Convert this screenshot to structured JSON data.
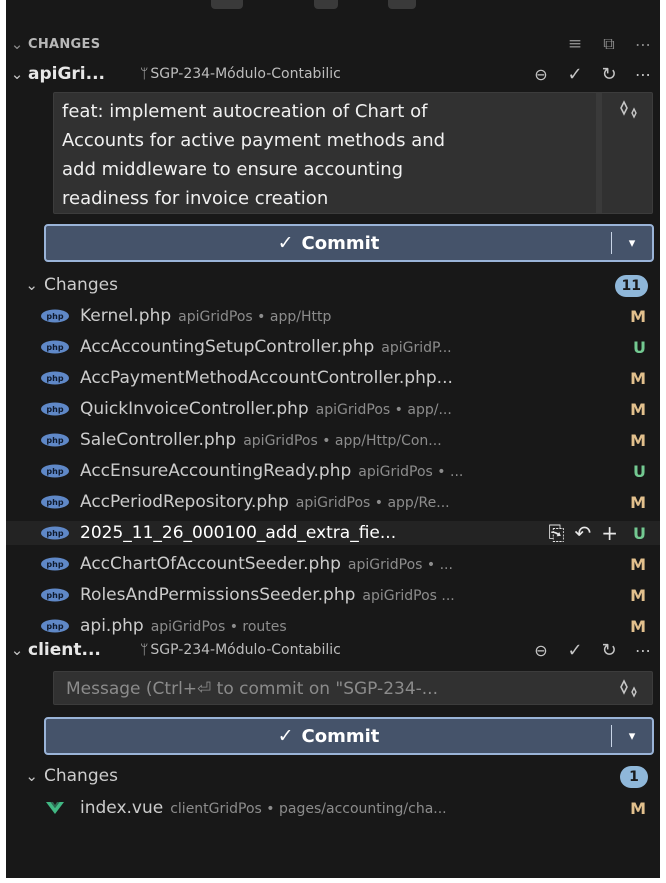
{
  "section": {
    "title": "CHANGES",
    "actions": [
      "list-view-icon",
      "collapse-all-icon",
      "more-icon"
    ]
  },
  "repos": [
    {
      "name": "apiGri...",
      "branch": "SGP-234-Módulo-Contabilic",
      "commit_message": "feat: implement autocreation of Chart of\nAccounts for active payment methods and\nadd middleware to ensure accounting\nreadiness for invoice creation",
      "commit_button": "Commit",
      "group_label": "Changes",
      "count": "11",
      "files": [
        {
          "name": "Kernel.php",
          "path": "apiGridPos • app/Http",
          "status": "M"
        },
        {
          "name": "AccAccountingSetupController.php",
          "path": "apiGridP...",
          "status": "U"
        },
        {
          "name": "AccPaymentMethodAccountController.php...",
          "path": "",
          "status": "M"
        },
        {
          "name": "QuickInvoiceController.php",
          "path": "apiGridPos • app/...",
          "status": "M"
        },
        {
          "name": "SaleController.php",
          "path": "apiGridPos • app/Http/Con...",
          "status": "M"
        },
        {
          "name": "AccEnsureAccountingReady.php",
          "path": "apiGridPos • ...",
          "status": "U"
        },
        {
          "name": "AccPeriodRepository.php",
          "path": "apiGridPos • app/Re...",
          "status": "M"
        },
        {
          "name": "2025_11_26_000100_add_extra_fie...",
          "path": "",
          "status": "U"
        },
        {
          "name": "AccChartOfAccountSeeder.php",
          "path": "apiGridPos • ...",
          "status": "M"
        },
        {
          "name": "RolesAndPermissionsSeeder.php",
          "path": "apiGridPos ...",
          "status": "M"
        },
        {
          "name": "api.php",
          "path": "apiGridPos • routes",
          "status": "M"
        }
      ]
    },
    {
      "name": "client...",
      "branch": "SGP-234-Módulo-Contabilic",
      "commit_placeholder": "Message (Ctrl+⏎ to commit on \"SGP-234-...",
      "commit_button": "Commit",
      "group_label": "Changes",
      "count": "1",
      "files": [
        {
          "name": "index.vue",
          "path": "clientGridPos • pages/accounting/cha...",
          "status": "M"
        }
      ]
    }
  ],
  "colors": {
    "background": "#181818",
    "commit_button": "#45536a",
    "modified": "#e2c08d",
    "untracked": "#73c991",
    "badge": "#8fb7d9"
  }
}
